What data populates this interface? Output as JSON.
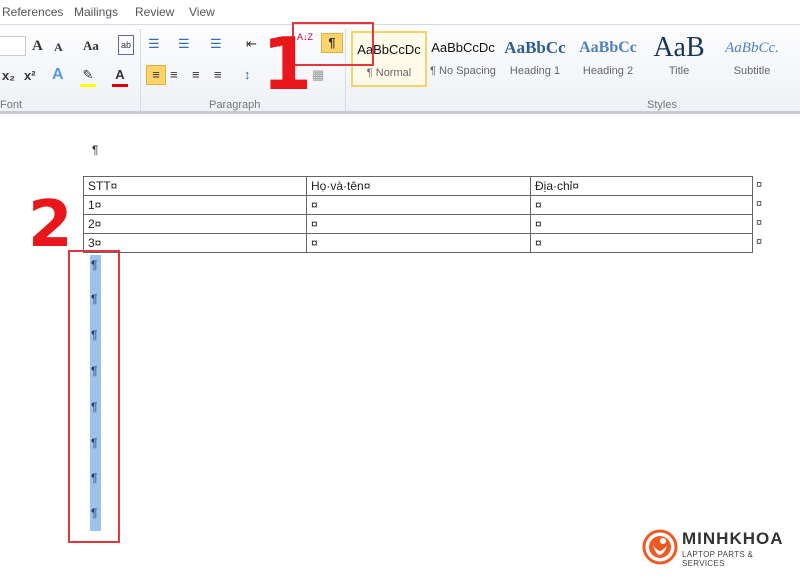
{
  "tabs": [
    "References",
    "Mailings",
    "Review",
    "View"
  ],
  "ribbon": {
    "groups": {
      "font": "Font",
      "paragraph": "Paragraph",
      "styles": "Styles"
    },
    "buttons": {
      "grow_font": "A",
      "shrink_font": "A",
      "change_case": "Aa",
      "clear_format": "ab",
      "subscript": "x₂",
      "superscript": "x²",
      "text_effects": "A",
      "highlight": "✎",
      "font_color": "A",
      "bullets": "☰",
      "numbering": "☰",
      "multilevel": "☰",
      "decrease_indent": "⇤",
      "increase_indent": "⇥",
      "sort": "A↓Z",
      "show_hide": "¶",
      "align_left": "≡",
      "center": "≡",
      "align_right": "≡",
      "justify": "≡",
      "line_spacing": "↕",
      "shading": "◆",
      "borders": "▦"
    },
    "styles": [
      {
        "preview": "AaBbCcDc",
        "name": "¶ Normal",
        "selected": true
      },
      {
        "preview": "AaBbCcDc",
        "name": "¶ No Spacing"
      },
      {
        "preview": "AaBbCc",
        "name": "Heading 1"
      },
      {
        "preview": "AaBbCc",
        "name": "Heading 2"
      },
      {
        "preview": "AaB",
        "name": "Title"
      },
      {
        "preview": "AaBbCc.",
        "name": "Subtitle"
      }
    ]
  },
  "document": {
    "pilcrow": "¶",
    "table": [
      [
        "STT¤",
        "Họ·và·tên¤",
        "Địa·chỉ¤"
      ],
      [
        "1¤",
        "¤",
        "¤"
      ],
      [
        "2¤",
        "¤",
        "¤"
      ],
      [
        "3¤",
        "¤",
        "¤"
      ]
    ],
    "row_end": "¤"
  },
  "annotations": {
    "step1": "1",
    "step2": "2",
    "color": "#e8171c"
  },
  "logo": {
    "brand": "MINHKHOA",
    "tagline": "LAPTOP PARTS & SERVICES",
    "color": "#f05a22"
  }
}
